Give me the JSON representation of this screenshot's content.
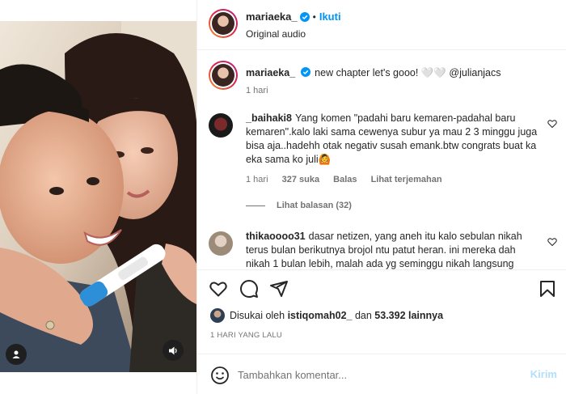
{
  "header": {
    "username": "mariaeka_",
    "separator": "•",
    "follow_label": "Ikuti",
    "audio": "Original audio"
  },
  "caption": {
    "username": "mariaeka_",
    "text": "new chapter let's gooo! 🤍🤍 @julianjacs",
    "time": "1 hari"
  },
  "comments": [
    {
      "username": "_baihaki8",
      "text": "Yang komen \"padahi baru kemaren-padahal baru kemaren\".kalo laki sama cewenya subur ya mau 2 3 minggu juga bisa aja..hadehh otak negativ susah emank.btw congrats buat ka eka sama ko juli🙆",
      "time": "1 hari",
      "likes": "327 suka",
      "reply": "Balas",
      "translate": "Lihat terjemahan",
      "view_replies": "Lihat balasan (32)"
    },
    {
      "username": "thikaoooo31",
      "text": "dasar netizen, yang aneh itu kalo sebulan nikah terus bulan berikutnya brojol ntu patut heran. ini mereka dah nikah 1 bulan lebih, malah ada yg seminggu nikah langsung"
    }
  ],
  "actions": {
    "icons": [
      "heart-icon",
      "comment-icon",
      "share-icon",
      "bookmark-icon"
    ]
  },
  "likes": {
    "prefix": "Disukai oleh",
    "user": "istiqomah02_",
    "middle": "dan",
    "count": "53.392 lainnya"
  },
  "timestamp": "1 HARI YANG LALU",
  "add_comment": {
    "placeholder": "Tambahkan komentar...",
    "send_label": "Kirim"
  },
  "colors": {
    "accent": "#0095f6",
    "send_disabled": "#b2dffc",
    "muted": "#737373",
    "text": "#262626"
  }
}
